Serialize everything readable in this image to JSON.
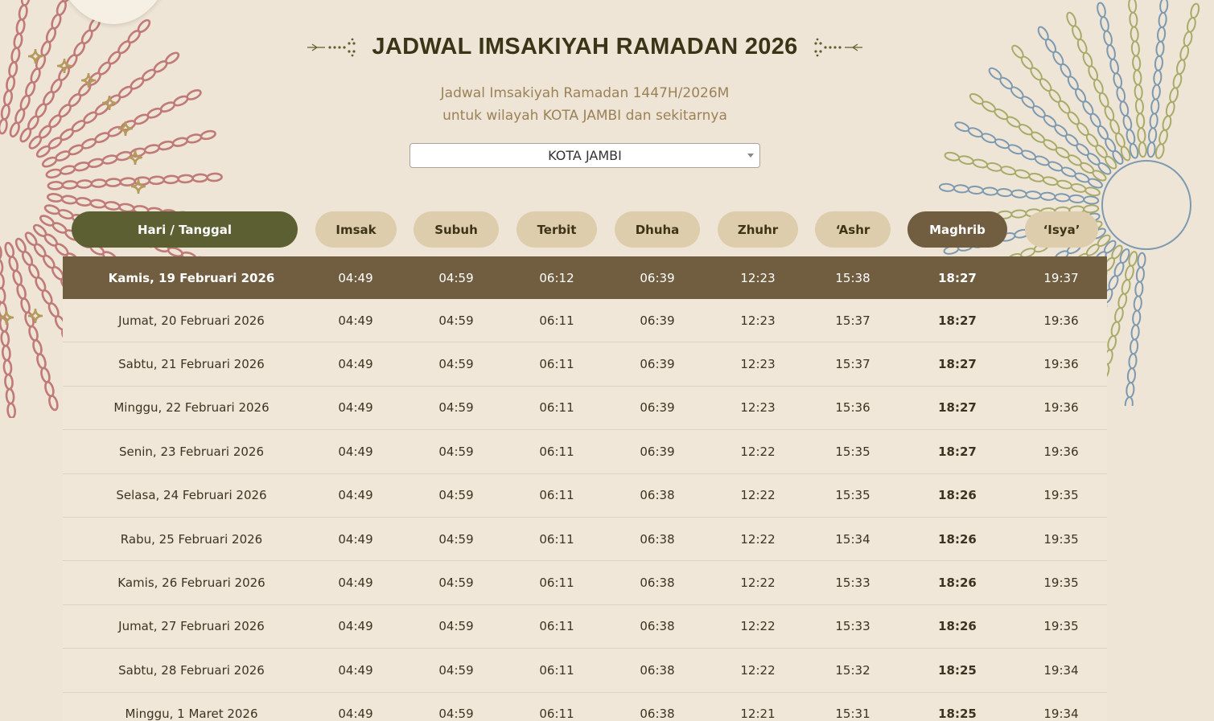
{
  "header": {
    "title": "JADWAL IMSAKIYAH RAMADAN 2026",
    "subtitle_line1": "Jadwal Imsakiyah Ramadan 1447H/2026M",
    "subtitle_line2": "untuk wilayah KOTA JAMBI dan sekitarnya"
  },
  "city_select": {
    "value": "KOTA JAMBI"
  },
  "columns": [
    "Hari / Tanggal",
    "Imsak",
    "Subuh",
    "Terbit",
    "Dhuha",
    "Zhuhr",
    "‘Ashr",
    "Maghrib",
    "‘Isya’"
  ],
  "rows": [
    {
      "date": "Kamis, 19 Februari 2026",
      "imsak": "04:49",
      "subuh": "04:59",
      "terbit": "06:12",
      "dhuha": "06:39",
      "zhuhr": "12:23",
      "ashr": "15:38",
      "maghrib": "18:27",
      "isya": "19:37"
    },
    {
      "date": "Jumat, 20 Februari 2026",
      "imsak": "04:49",
      "subuh": "04:59",
      "terbit": "06:11",
      "dhuha": "06:39",
      "zhuhr": "12:23",
      "ashr": "15:37",
      "maghrib": "18:27",
      "isya": "19:36"
    },
    {
      "date": "Sabtu, 21 Februari 2026",
      "imsak": "04:49",
      "subuh": "04:59",
      "terbit": "06:11",
      "dhuha": "06:39",
      "zhuhr": "12:23",
      "ashr": "15:37",
      "maghrib": "18:27",
      "isya": "19:36"
    },
    {
      "date": "Minggu, 22 Februari 2026",
      "imsak": "04:49",
      "subuh": "04:59",
      "terbit": "06:11",
      "dhuha": "06:39",
      "zhuhr": "12:23",
      "ashr": "15:36",
      "maghrib": "18:27",
      "isya": "19:36"
    },
    {
      "date": "Senin, 23 Februari 2026",
      "imsak": "04:49",
      "subuh": "04:59",
      "terbit": "06:11",
      "dhuha": "06:39",
      "zhuhr": "12:22",
      "ashr": "15:35",
      "maghrib": "18:27",
      "isya": "19:36"
    },
    {
      "date": "Selasa, 24 Februari 2026",
      "imsak": "04:49",
      "subuh": "04:59",
      "terbit": "06:11",
      "dhuha": "06:38",
      "zhuhr": "12:22",
      "ashr": "15:35",
      "maghrib": "18:26",
      "isya": "19:35"
    },
    {
      "date": "Rabu, 25 Februari 2026",
      "imsak": "04:49",
      "subuh": "04:59",
      "terbit": "06:11",
      "dhuha": "06:38",
      "zhuhr": "12:22",
      "ashr": "15:34",
      "maghrib": "18:26",
      "isya": "19:35"
    },
    {
      "date": "Kamis, 26 Februari 2026",
      "imsak": "04:49",
      "subuh": "04:59",
      "terbit": "06:11",
      "dhuha": "06:38",
      "zhuhr": "12:22",
      "ashr": "15:33",
      "maghrib": "18:26",
      "isya": "19:35"
    },
    {
      "date": "Jumat, 27 Februari 2026",
      "imsak": "04:49",
      "subuh": "04:59",
      "terbit": "06:11",
      "dhuha": "06:38",
      "zhuhr": "12:22",
      "ashr": "15:33",
      "maghrib": "18:26",
      "isya": "19:35"
    },
    {
      "date": "Sabtu, 28 Februari 2026",
      "imsak": "04:49",
      "subuh": "04:59",
      "terbit": "06:11",
      "dhuha": "06:38",
      "zhuhr": "12:22",
      "ashr": "15:32",
      "maghrib": "18:25",
      "isya": "19:34"
    },
    {
      "date": "Minggu, 1 Maret 2026",
      "imsak": "04:49",
      "subuh": "04:59",
      "terbit": "06:11",
      "dhuha": "06:38",
      "zhuhr": "12:21",
      "ashr": "15:31",
      "maghrib": "18:25",
      "isya": "19:34"
    }
  ],
  "colors": {
    "background": "#efe5d6",
    "date_header": "#5c5f32",
    "accent_brown": "#715e40",
    "pill": "#ddcdac",
    "title": "#3b3518",
    "subtitle": "#9a8158",
    "ornament_rose": "#c07a77",
    "ornament_gold": "#b59a5e",
    "ornament_blue": "#7d9ab0",
    "ornament_olive": "#a8ab6a"
  }
}
